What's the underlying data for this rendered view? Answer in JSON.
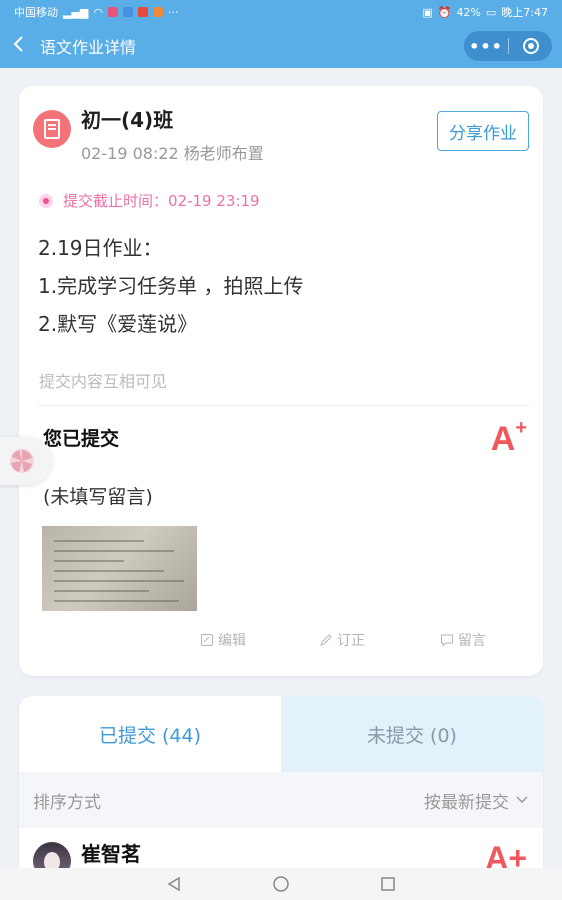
{
  "status_bar": {
    "carrier": "中国移动",
    "battery": "42%",
    "time": "晚上7:47"
  },
  "header": {
    "title": "语文作业详情",
    "menu_icon": "more-dots-icon",
    "close_icon": "target-icon"
  },
  "assignment": {
    "class_name": "初一(4)班",
    "meta": "02-19 08:22 杨老师布置",
    "share_label": "分享作业",
    "deadline": "提交截止时间：02-19 23:19",
    "lines": [
      "2.19日作业：",
      "1.完成学习任务单 ，拍照上传",
      "2.默写《爱莲说》"
    ],
    "visibility": "提交内容互相可见"
  },
  "submission": {
    "title": "您已提交",
    "grade": "A",
    "grade_suffix": "+",
    "comment": "(未填写留言)",
    "actions": {
      "edit": "编辑",
      "correct": "订正",
      "comment": "留言"
    }
  },
  "list": {
    "tab_submitted": "已提交 (44)",
    "tab_unsubmitted": "未提交 (0)",
    "sort_label": "排序方式",
    "sort_value": "按最新提交",
    "students": [
      {
        "name": "崔智茗",
        "grade": "A+"
      }
    ]
  },
  "colors": {
    "accent": "#3d9ad9",
    "header_bg": "#5aaee8",
    "grade_red": "#f0585e",
    "deadline_pink": "#ee6fa8"
  }
}
